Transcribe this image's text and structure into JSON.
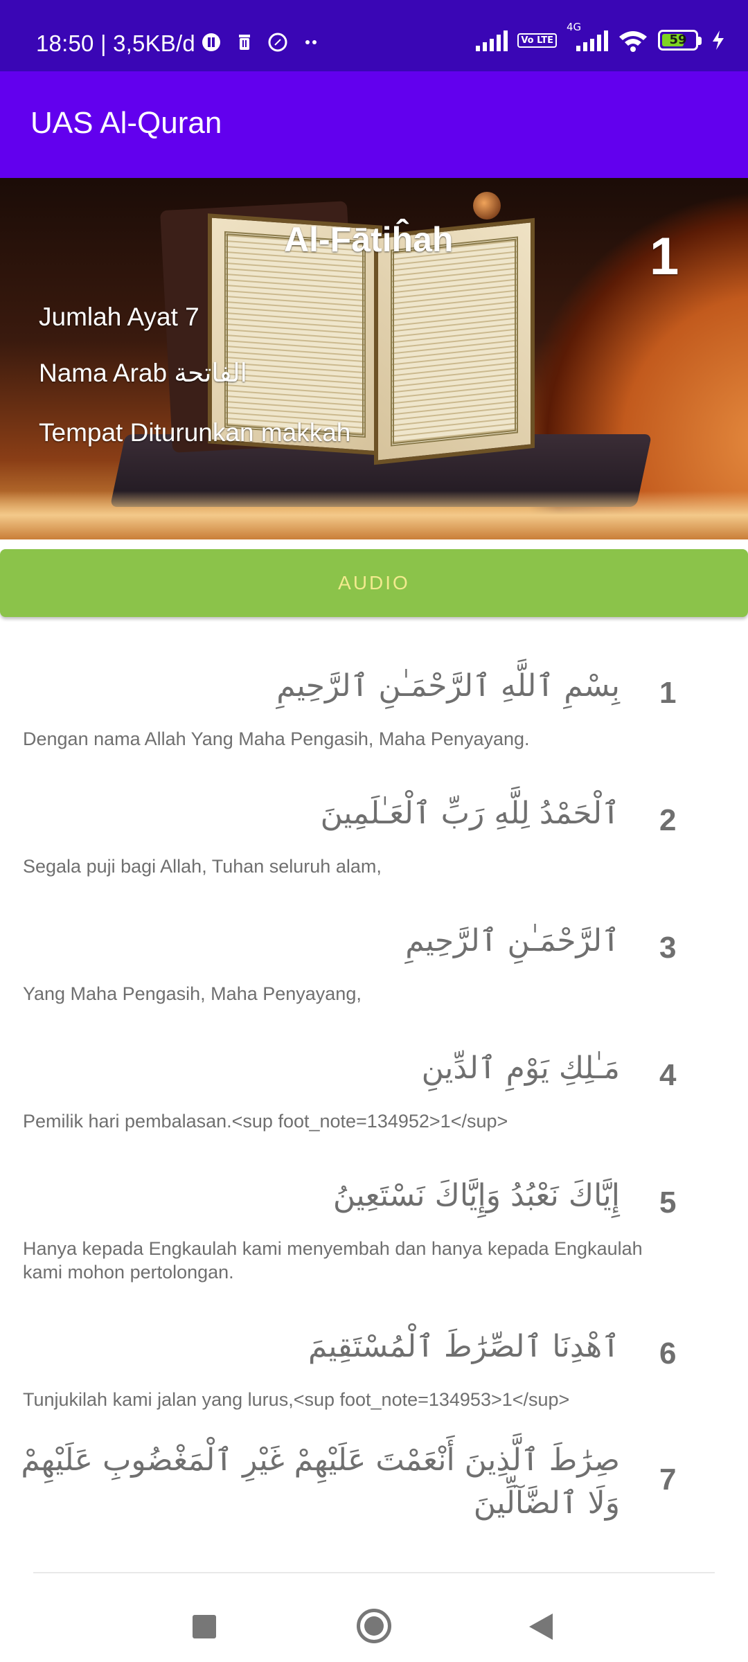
{
  "status_bar": {
    "time": "18:50 | 3,5KB/d",
    "left_icons": [
      "pause-circle-icon",
      "trash-icon",
      "compass-icon",
      "more-dots-icon"
    ],
    "network_label": "4G",
    "volte_label": "Vo LTE",
    "battery": "59"
  },
  "app_bar": {
    "title": "UAS Al-Quran"
  },
  "surah": {
    "name": "Al-Fātiĥah",
    "number": "1",
    "jumlah_ayat": "Jumlah Ayat 7",
    "nama_arab": "Nama Arab الفاتحة",
    "tempat": "Tempat Diturunkan makkah"
  },
  "audio_button": "AUDIO",
  "ayat": [
    {
      "number": "1",
      "arab": "بِسْمِ ٱللَّهِ ٱلرَّحْمَـٰنِ ٱلرَّحِيمِ",
      "terjemahan": "Dengan nama Allah Yang Maha Pengasih, Maha Penyayang."
    },
    {
      "number": "2",
      "arab": "ٱلْحَمْدُ لِلَّهِ رَبِّ ٱلْعَـٰلَمِينَ",
      "terjemahan": "Segala puji bagi Allah, Tuhan seluruh alam,"
    },
    {
      "number": "3",
      "arab": "ٱلرَّحْمَـٰنِ ٱلرَّحِيمِ",
      "terjemahan": "Yang Maha Pengasih, Maha Penyayang,"
    },
    {
      "number": "4",
      "arab": "مَـٰلِكِ يَوْمِ ٱلدِّينِ",
      "terjemahan": "Pemilik hari pembalasan.<sup foot_note=134952>1</sup>"
    },
    {
      "number": "5",
      "arab": "إِيَّاكَ نَعْبُدُ وَإِيَّاكَ نَسْتَعِينُ",
      "terjemahan": "Hanya kepada Engkaulah kami menyembah dan hanya kepada Engkaulah kami mohon pertolongan."
    },
    {
      "number": "6",
      "arab": "ٱهْدِنَا ٱلصِّرَٰطَ ٱلْمُسْتَقِيمَ",
      "terjemahan": "Tunjukilah kami jalan yang lurus,<sup foot_note=134953>1</sup>"
    },
    {
      "number": "7",
      "arab": "صِرَٰطَ ٱلَّذِينَ أَنْعَمْتَ عَلَيْهِمْ غَيْرِ ٱلْمَغْضُوبِ عَلَيْهِمْ وَلَا ٱلضَّآلِّينَ",
      "terjemahan": ""
    }
  ],
  "nav_bar": {
    "icons": [
      "recents-square-icon",
      "home-circle-icon",
      "back-triangle-icon"
    ]
  }
}
